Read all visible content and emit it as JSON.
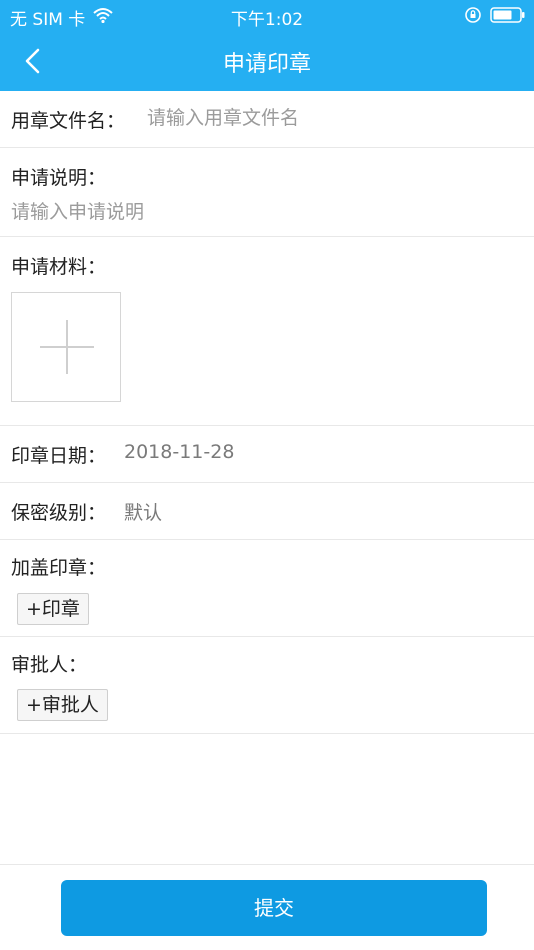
{
  "status_bar": {
    "carrier": "无 SIM 卡",
    "time": "下午1:02",
    "wifi_icon": "wifi-icon",
    "lock_icon": "orientation-lock-icon",
    "battery_icon": "battery-icon"
  },
  "nav": {
    "back_icon": "chevron-left-icon",
    "title": "申请印章"
  },
  "form": {
    "file_name": {
      "label": "用章文件名：",
      "placeholder": "请输入用章文件名",
      "value": ""
    },
    "description": {
      "label": "申请说明：",
      "placeholder": "请输入申请说明",
      "value": ""
    },
    "materials": {
      "label": "申请材料：",
      "add_icon": "plus-icon"
    },
    "seal_date": {
      "label": "印章日期：",
      "value": "2018-11-28"
    },
    "secrecy": {
      "label": "保密级别：",
      "value": "默认"
    },
    "stamp": {
      "label": "加盖印章：",
      "button": "+印章"
    },
    "approver": {
      "label": "审批人：",
      "button": "+审批人"
    }
  },
  "submit_label": "提交",
  "colors": {
    "header": "#25aff2",
    "submit": "#0e9ae2",
    "placeholder": "#9b9b9b",
    "divider": "#e8e8e8"
  }
}
